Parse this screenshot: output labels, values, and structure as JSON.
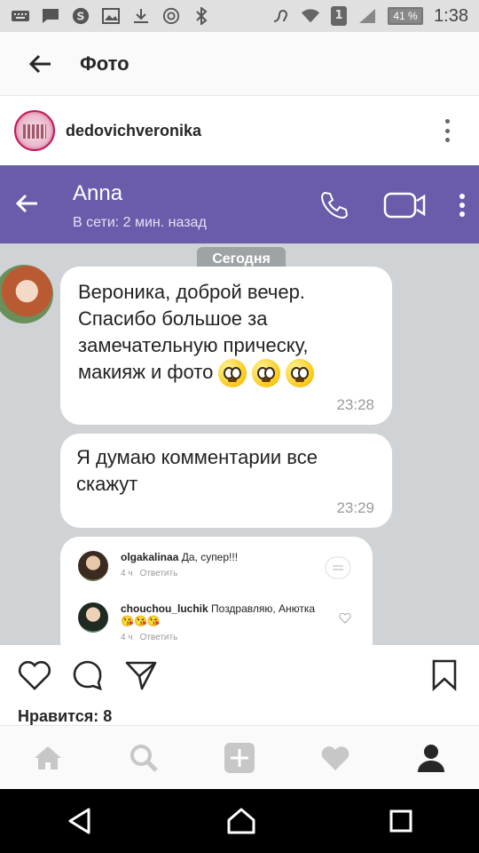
{
  "status_bar": {
    "battery": "41 %",
    "time": "1:38",
    "sim": "1"
  },
  "header": {
    "title": "Фото"
  },
  "post": {
    "author": "dedovichveronika",
    "likes": "Нравится: 8"
  },
  "chat": {
    "contact_name": "Anna",
    "contact_status": "В сети: 2 мин. назад",
    "day_label": "Сегодня",
    "messages": [
      {
        "text": "Вероника, доброй вечер. Спасибо большое за замечательную прическу, макияж и фото",
        "time": "23:28"
      },
      {
        "text": "Я думаю комментарии все скажут",
        "time": "23:29"
      }
    ],
    "comments": [
      {
        "user": "olgakalinaa",
        "text": "Да, супер!!!",
        "age": "4 ч",
        "reply": "Ответить"
      },
      {
        "user": "chouchou_luchik",
        "text": "Поздравляю, Анютка 😘😘😘",
        "age": "4 ч",
        "reply": "Ответить"
      }
    ]
  },
  "colors": {
    "viber": "#6a5cab",
    "chat_bg": "#cfd3d5"
  }
}
